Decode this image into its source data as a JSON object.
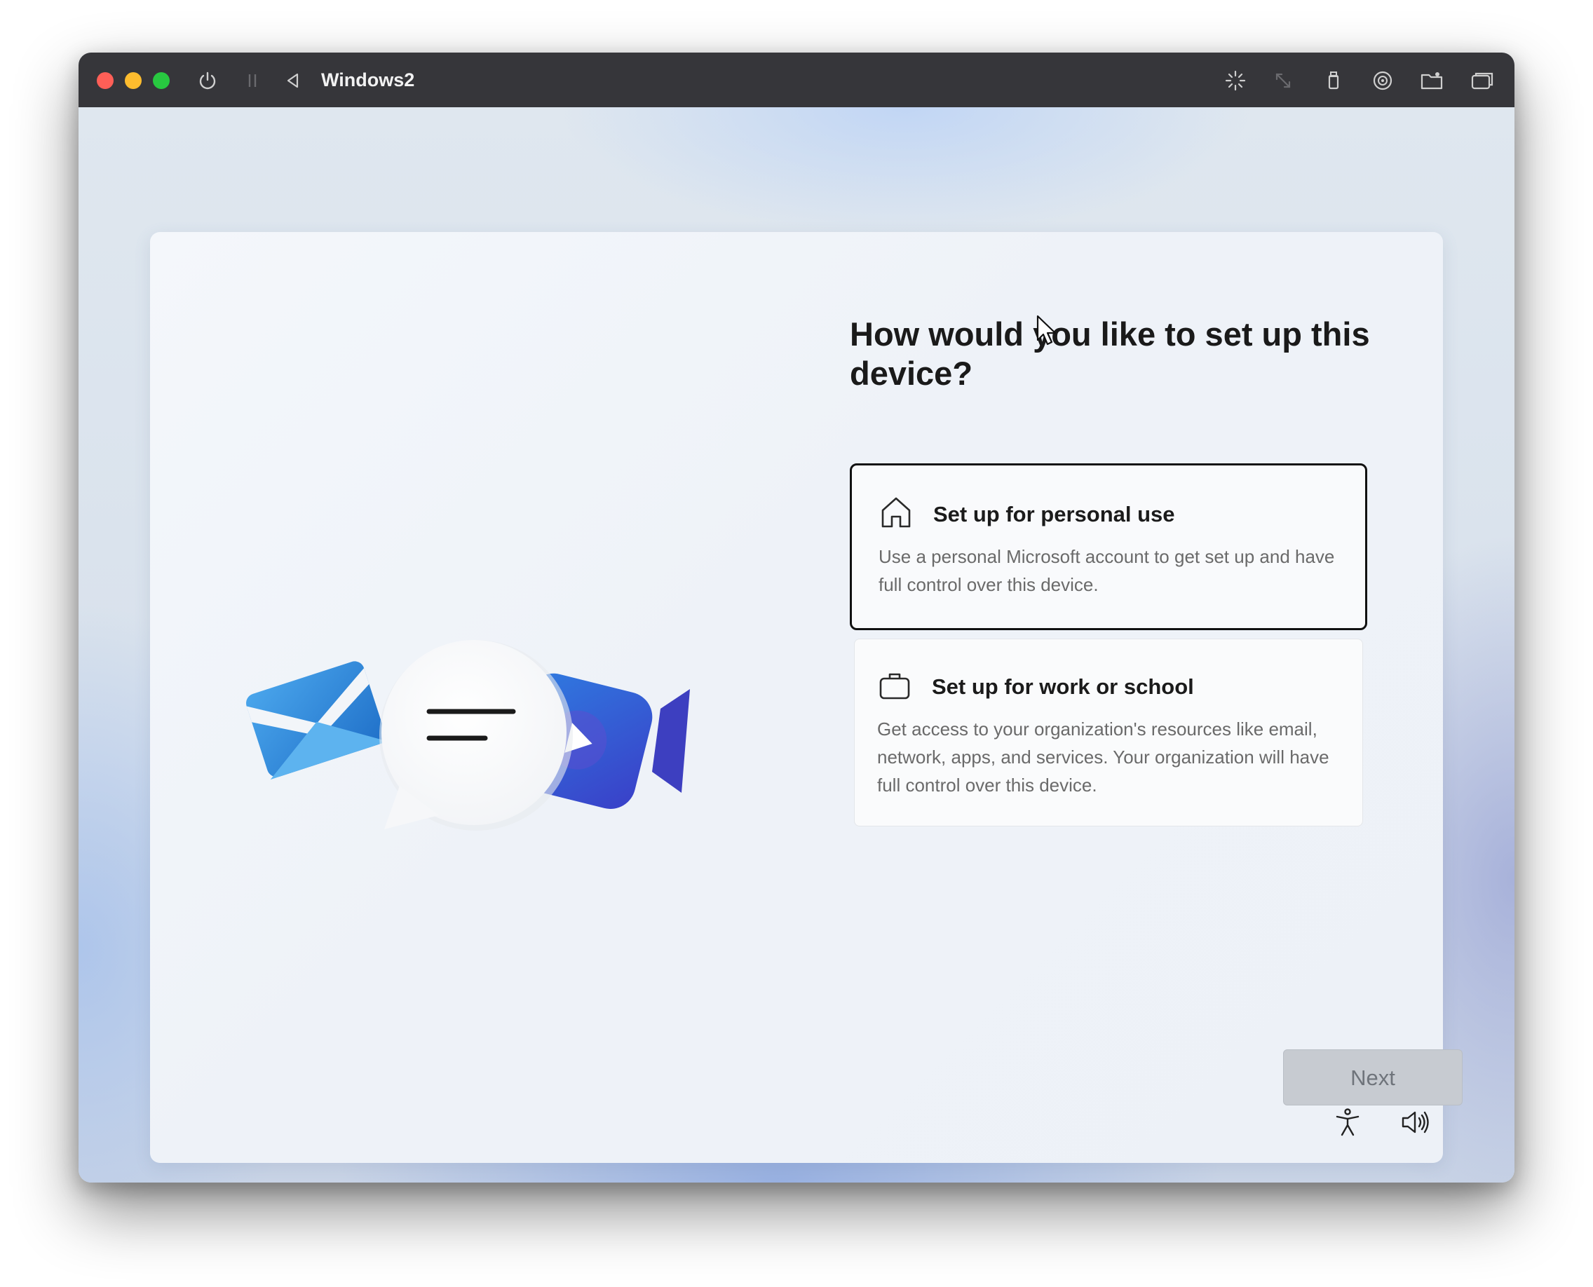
{
  "window": {
    "title": "Windows2"
  },
  "toolbar_icons": [
    "power-icon",
    "pause-icon",
    "back-icon",
    "brightness-icon",
    "resize-icon",
    "usb-icon",
    "disc-icon",
    "shared-folder-icon",
    "display-icon"
  ],
  "oobe": {
    "heading": "How would you like to set up this device?",
    "options": [
      {
        "icon": "home-icon",
        "title": "Set up for personal use",
        "description": "Use a personal Microsoft account to get set up and have full control over this device.",
        "selected": true
      },
      {
        "icon": "briefcase-icon",
        "title": "Set up for work or school",
        "description": "Get access to your organization's resources like email, network, apps, and services. Your organization will have full control over this device.",
        "selected": false
      }
    ],
    "next_label": "Next",
    "next_enabled": false
  },
  "footer_icons": [
    "accessibility-icon",
    "volume-icon"
  ],
  "colors": {
    "titlebar": "#36363a",
    "selected_border": "#111111",
    "next_disabled_bg": "#c7cbd1",
    "illustration_mail": "#3c8fdd",
    "illustration_video": "#3a55d4"
  }
}
